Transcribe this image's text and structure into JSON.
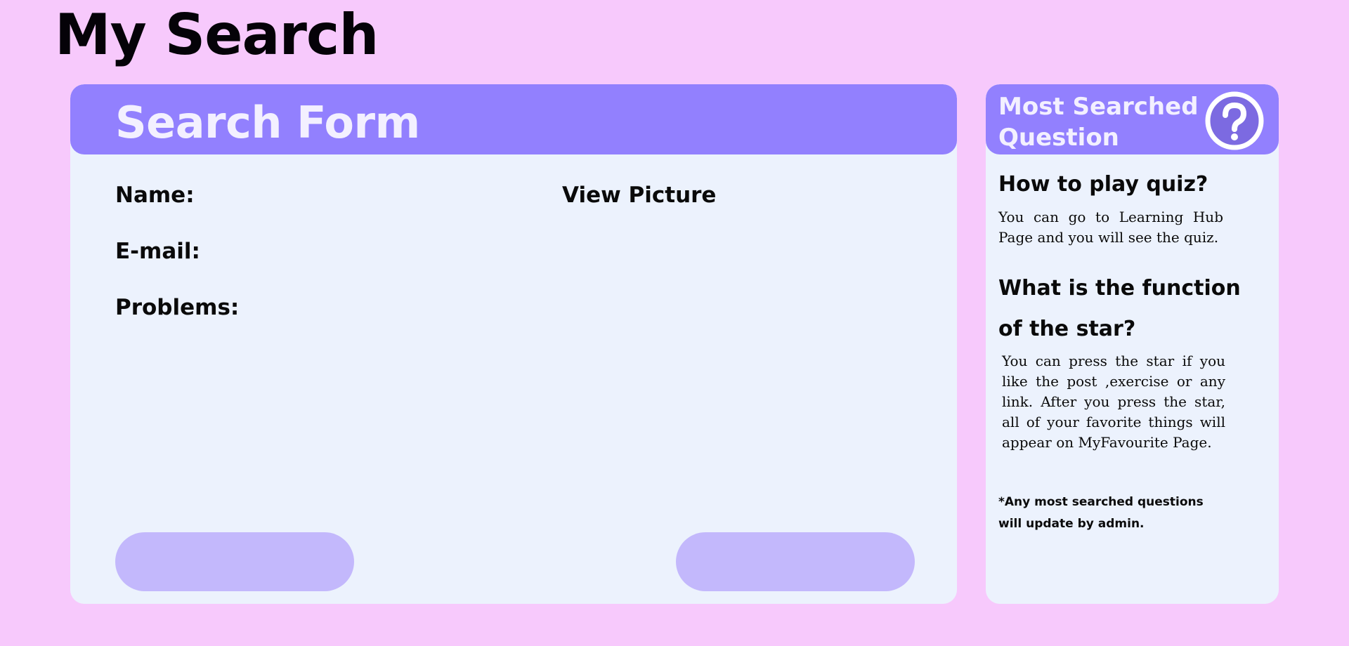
{
  "page": {
    "title": "My Search"
  },
  "search_form": {
    "title": "Search Form",
    "fields": {
      "name_label": "Name:",
      "email_label": "E-mail:",
      "problems_label": "Problems:"
    },
    "view_picture_label": "View Picture",
    "buttons": {
      "left_label": "",
      "right_label": ""
    }
  },
  "most_searched": {
    "title": "Most Searched Question",
    "icon": "question-circle-icon",
    "items": [
      {
        "question": "How to play quiz?",
        "answer": "You can go to Learning Hub Page and you will see the quiz."
      },
      {
        "question": "What is the function of the star?",
        "answer": "You can press the star if you like the post ,exercise or any link. After you press the star, all of your favorite things will appear on MyFavourite Page."
      }
    ],
    "note": "*Any most searched questions will update by admin."
  },
  "colors": {
    "background": "#f7c9fc",
    "card": "#ecf2fd",
    "header": "#9280fe",
    "button": "#c3b8fc",
    "header_text": "#f3f0ff"
  }
}
